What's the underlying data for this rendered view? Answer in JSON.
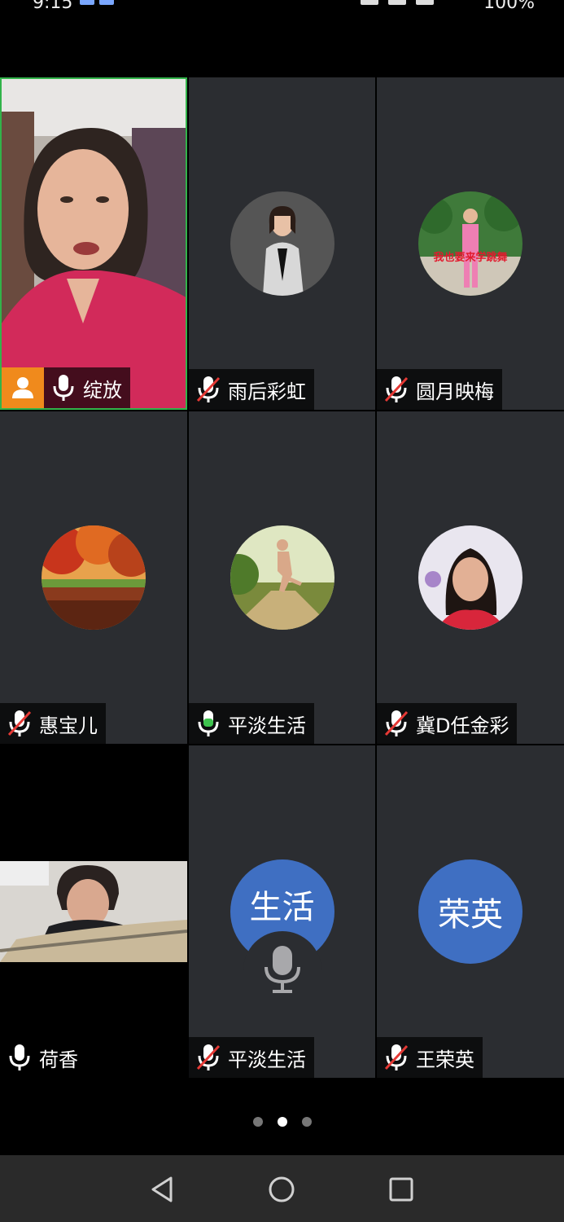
{
  "status_bar": {
    "time": "9:15",
    "battery": "100%"
  },
  "participants": [
    {
      "name": "绽放",
      "mic": "on",
      "host": true,
      "active": true,
      "view": "video-woman-red-top"
    },
    {
      "name": "雨后彩虹",
      "mic": "muted",
      "view": "avatar-photo"
    },
    {
      "name": "圆月映梅",
      "mic": "muted",
      "view": "avatar-photo",
      "avatar_caption": "我也要来学跳舞"
    },
    {
      "name": "惠宝儿",
      "mic": "muted",
      "view": "avatar-photo"
    },
    {
      "name": "平淡生活",
      "mic": "speaking",
      "view": "avatar-photo"
    },
    {
      "name": "冀D任金彩",
      "mic": "muted",
      "view": "avatar-photo"
    },
    {
      "name": "荷香",
      "mic": "on",
      "view": "video-reading"
    },
    {
      "name": "平淡生活",
      "mic": "muted",
      "view": "avatar-text",
      "avatar_text": "生活",
      "speaking_indicator": "microphone-icon"
    },
    {
      "name": "王荣英",
      "mic": "muted",
      "view": "avatar-text",
      "avatar_text": "荣英"
    }
  ],
  "pagination": {
    "pages": 3,
    "current": 2
  },
  "nav": [
    "back-icon",
    "home-icon",
    "recents-icon"
  ],
  "colors": {
    "active_border": "#32b34a",
    "host_badge": "#f08a1c",
    "avatar_bg": "#3f6fc2",
    "tile_bg": "#2b2d31",
    "speaking_green": "#3ec34e"
  }
}
